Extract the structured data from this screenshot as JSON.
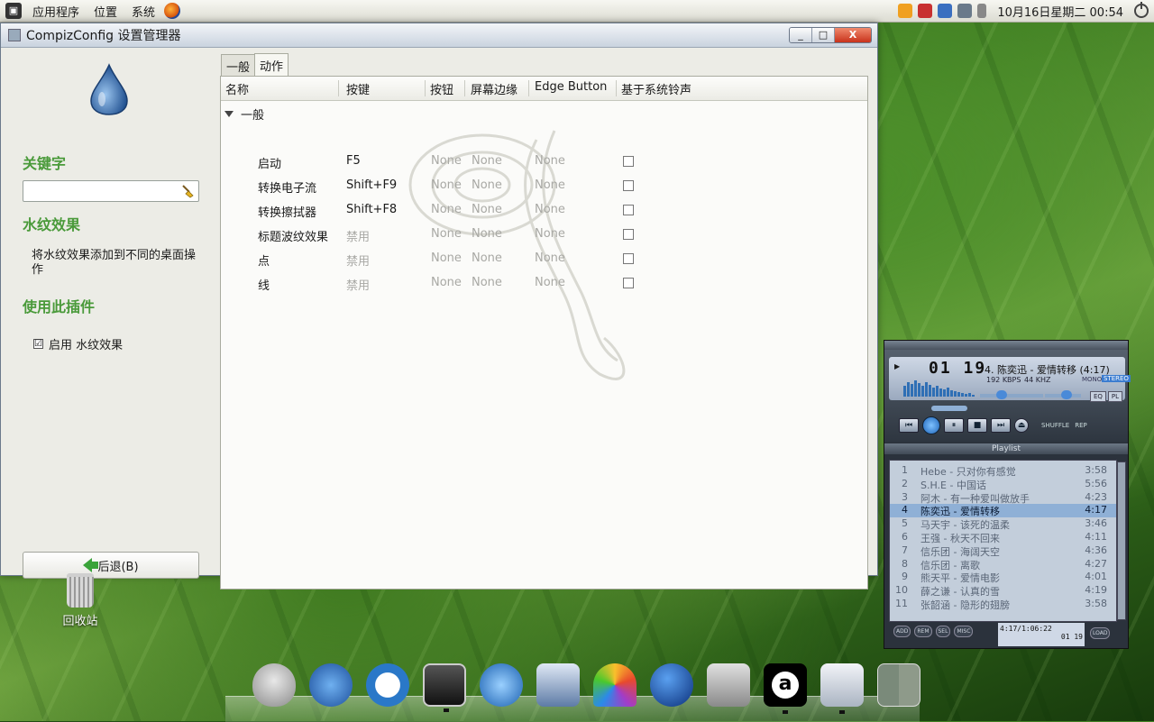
{
  "top_panel": {
    "menus": [
      "应用程序",
      "位置",
      "系统"
    ],
    "clock": "10月16日星期二 00:54"
  },
  "window": {
    "title": "CompizConfig 设置管理器",
    "controls": [
      "_",
      "□",
      "X"
    ]
  },
  "sidebar": {
    "keyword_heading": "关键字",
    "search_value": "",
    "plugin_heading": "水纹效果",
    "plugin_desc": "将水纹效果添加到不同的桌面操作",
    "use_heading": "使用此插件",
    "enable_label": "启用 水纹效果",
    "enable_checked": "☑",
    "back_label": "后退(B)"
  },
  "tabs": [
    {
      "label": "一般",
      "active": false
    },
    {
      "label": "动作",
      "active": true
    }
  ],
  "table": {
    "columns": [
      "名称",
      "按键",
      "按钮",
      "屏幕边缘",
      "Edge Button",
      "基于系统铃声"
    ],
    "group": "一般",
    "rows": [
      {
        "name": "启动",
        "key": "F5",
        "button": "None",
        "edge": "None",
        "edge_button": "None",
        "bell": false
      },
      {
        "name": "转换电子流",
        "key": "Shift+F9",
        "button": "None",
        "edge": "None",
        "edge_button": "None",
        "bell": false
      },
      {
        "name": "转换擦拭器",
        "key": "Shift+F8",
        "button": "None",
        "edge": "None",
        "edge_button": "None",
        "bell": false
      },
      {
        "name": "标题波纹效果",
        "key": "禁用",
        "button": "None",
        "edge": "None",
        "edge_button": "None",
        "bell": false
      },
      {
        "name": "点",
        "key": "禁用",
        "button": "None",
        "edge": "None",
        "edge_button": "None",
        "bell": false
      },
      {
        "name": "线",
        "key": "禁用",
        "button": "None",
        "edge": "None",
        "edge_button": "None",
        "bell": false
      }
    ]
  },
  "desktop": {
    "trash_label": "回收站"
  },
  "player": {
    "time": "01 19",
    "track": "4. 陈奕迅 - 爱情转移 (4:17)",
    "kbps": "192 KBPS",
    "khz": "44 KHZ",
    "mono": "MONO",
    "stereo": "STEREO",
    "eq": "EQ",
    "pl": "PL",
    "shuffle": "SHUFFLE",
    "repeat": "REP",
    "playlist_title": "Playlist",
    "playlist": [
      {
        "n": "1",
        "title": "Hebe - 只对你有感觉",
        "dur": "3:58"
      },
      {
        "n": "2",
        "title": "S.H.E - 中国话",
        "dur": "5:56"
      },
      {
        "n": "3",
        "title": "阿木 - 有一种爱叫做放手",
        "dur": "4:23"
      },
      {
        "n": "4",
        "title": "陈奕迅 - 爱情转移",
        "dur": "4:17",
        "selected": true
      },
      {
        "n": "5",
        "title": "马天宇 - 该死的温柔",
        "dur": "3:46"
      },
      {
        "n": "6",
        "title": "王强 - 秋天不回来",
        "dur": "4:11"
      },
      {
        "n": "7",
        "title": "信乐团 - 海阔天空",
        "dur": "4:36"
      },
      {
        "n": "8",
        "title": "信乐团 - 离歌",
        "dur": "4:27"
      },
      {
        "n": "9",
        "title": "熊天平 - 爱情电影",
        "dur": "4:01"
      },
      {
        "n": "10",
        "title": "薛之谦 - 认真的雪",
        "dur": "4:19"
      },
      {
        "n": "11",
        "title": "张韶涵 - 隐形的翅膀",
        "dur": "3:58"
      }
    ],
    "playlist_buttons": [
      "ADD",
      "REM",
      "SEL",
      "MISC",
      "LOAD"
    ],
    "info_line1": "4:17/1:06:22",
    "info_time": "01 19"
  },
  "dock_icons": [
    "apple-icon",
    "network-icon",
    "term-icon",
    "terminal-icon",
    "update-icon",
    "network-manager-icon",
    "photo-icon",
    "globe-icon",
    "disk-icon",
    "amarok-icon",
    "settings-manager-icon",
    "workspace-switcher-icon"
  ],
  "colors": {
    "accent_green": "#4a9a3a",
    "selection_blue": "#8fb0d6"
  }
}
